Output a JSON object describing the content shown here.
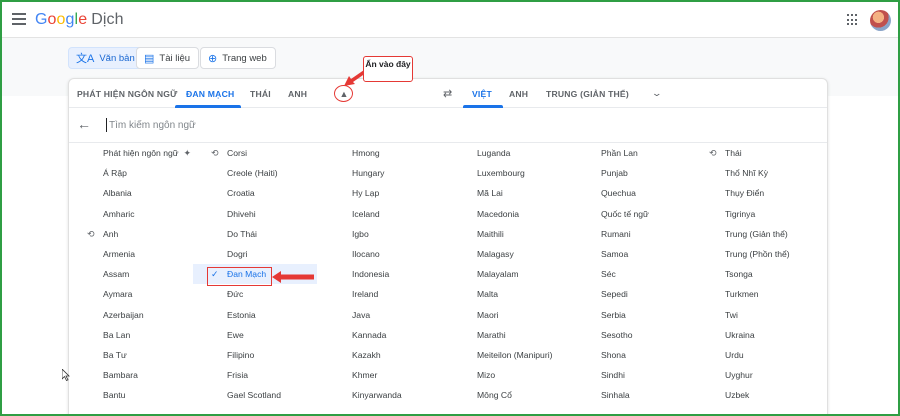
{
  "app": {
    "logo_g": "G",
    "logo_o1": "o",
    "logo_o2": "o",
    "logo_g2": "g",
    "logo_l": "l",
    "logo_e": "e",
    "product": "Dịch"
  },
  "modes": [
    {
      "label": "Văn bản",
      "icon": "translate-icon"
    },
    {
      "label": "Tài liệu",
      "icon": "document-icon"
    },
    {
      "label": "Trang web",
      "icon": "globe-icon"
    }
  ],
  "source_tabs": [
    "PHÁT HIỆN NGÔN NGỮ",
    "ĐAN MẠCH",
    "THÁI",
    "ANH"
  ],
  "target_tabs": [
    "VIỆT",
    "ANH",
    "TRUNG (GIẢN THỂ)"
  ],
  "search": {
    "placeholder": "Tìm kiếm ngôn ngữ"
  },
  "annotation": {
    "callout": "Ấn vào đây"
  },
  "colors": {
    "accent": "#1a73e8",
    "annotation": "#e53935",
    "frame": "#2f9e44"
  },
  "languages": [
    [
      "Phát hiện ngôn ngữ",
      "Á Rập",
      "Albania",
      "Amharic",
      "Anh",
      "Armenia",
      "Assam",
      "Aymara",
      "Azerbaijan",
      "Ba Lan",
      "Ba Tư",
      "Bambara",
      "Bantu"
    ],
    [
      "Corsi",
      "Creole (Haiti)",
      "Croatia",
      "Dhivehi",
      "Do Thái",
      "Dogri",
      "Đan Mạch",
      "Đức",
      "Estonia",
      "Ewe",
      "Filipino",
      "Frisia",
      "Gael Scotland"
    ],
    [
      "Hmong",
      "Hungary",
      "Hy Lạp",
      "Iceland",
      "Igbo",
      "Ilocano",
      "Indonesia",
      "Ireland",
      "Java",
      "Kannada",
      "Kazakh",
      "Khmer",
      "Kinyarwanda"
    ],
    [
      "Luganda",
      "Luxembourg",
      "Mã Lai",
      "Macedonia",
      "Maithili",
      "Malagasy",
      "Malayalam",
      "Malta",
      "Maori",
      "Marathi",
      "Meiteilon (Manipuri)",
      "Mizo",
      "Mông Cổ"
    ],
    [
      "Phần Lan",
      "Punjab",
      "Quechua",
      "Quốc tế ngữ",
      "Rumani",
      "Samoa",
      "Séc",
      "Sepedi",
      "Serbia",
      "Sesotho",
      "Shona",
      "Sindhi",
      "Sinhala"
    ],
    [
      "Thái",
      "Thổ Nhĩ Kỳ",
      "Thụy Điển",
      "Tigrinya",
      "Trung (Giản thể)",
      "Trung (Phồn thể)",
      "Tsonga",
      "Turkmen",
      "Twi",
      "Ukraina",
      "Urdu",
      "Uyghur",
      "Uzbek"
    ]
  ]
}
